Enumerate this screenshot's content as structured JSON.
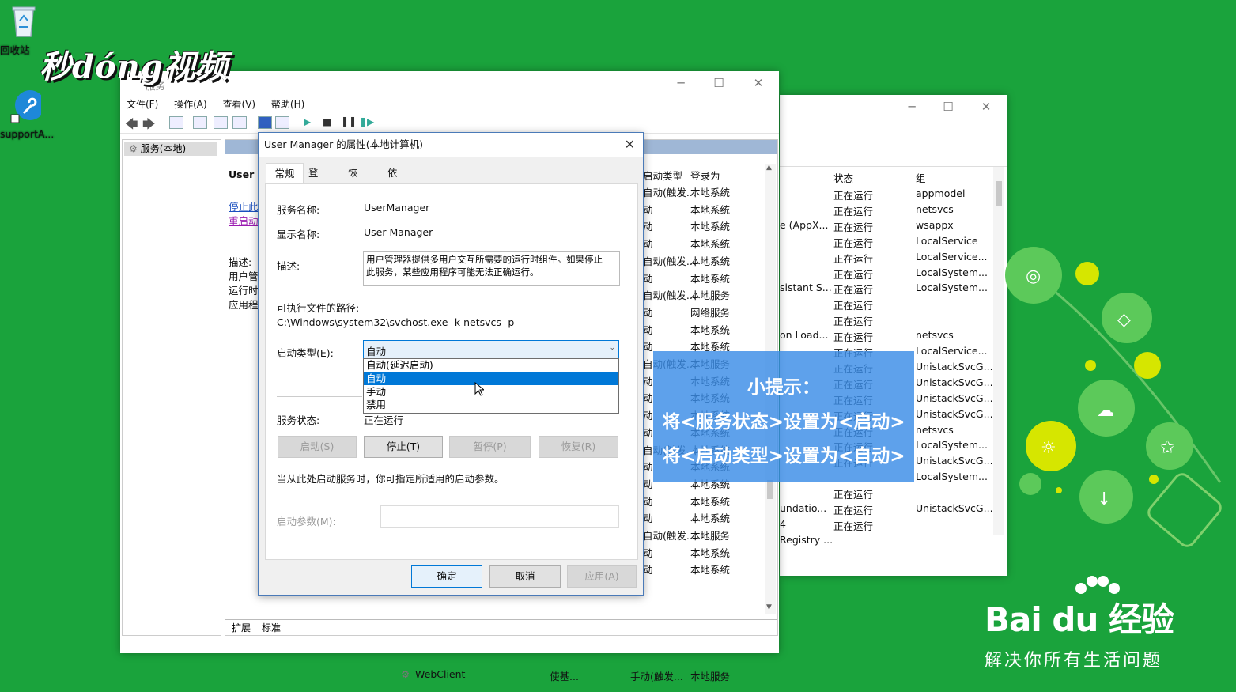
{
  "desktop": {
    "recycle_bin_label": "回收站",
    "support_label": "supportA..."
  },
  "watermark": "秒dóng视频",
  "services_window": {
    "title": "服务",
    "menu": [
      "文件(F)",
      "操作(A)",
      "查看(V)",
      "帮助(H)"
    ],
    "tree_item": "服务(本地)",
    "left_info": {
      "header": "User I",
      "stop_link": "停止此",
      "restart_link": "重启动",
      "desc_label": "描述:",
      "desc_lines": [
        "用户管",
        "运行时",
        "应用程"
      ]
    },
    "columns": {
      "startup_type": "启动类型",
      "logon_as": "登录为"
    },
    "rows_visible": [
      {
        "startup": "自动(触发...",
        "logon": "本地系统"
      },
      {
        "startup": "动",
        "logon": "本地系统"
      },
      {
        "startup": "动",
        "logon": "本地系统"
      },
      {
        "startup": "动",
        "logon": "本地系统"
      },
      {
        "startup": "自动(触发...",
        "logon": "本地系统"
      },
      {
        "startup": "动",
        "logon": "本地系统"
      },
      {
        "startup": "自动(触发...",
        "logon": "本地服务"
      },
      {
        "startup": "动",
        "logon": "网络服务"
      },
      {
        "startup": "动",
        "logon": "本地系统"
      },
      {
        "startup": "动",
        "logon": "本地系统"
      },
      {
        "startup": "自动(触发...",
        "logon": "本地服务"
      },
      {
        "startup": "动",
        "logon": "本地系统"
      },
      {
        "startup": "动",
        "logon": "本地系统"
      },
      {
        "startup": "动",
        "logon": "本地系统"
      },
      {
        "startup": "动",
        "logon": "本地系统"
      },
      {
        "startup": "自动(触发...",
        "logon": "本地系统"
      },
      {
        "startup": "动",
        "logon": "本地系统"
      },
      {
        "startup": "动",
        "logon": "本地系统"
      },
      {
        "startup": "动",
        "logon": "本地系统"
      },
      {
        "startup": "动",
        "logon": "本地系统"
      },
      {
        "startup": "自动(触发...",
        "logon": "本地服务"
      },
      {
        "startup": "动",
        "logon": "本地系统"
      },
      {
        "startup": "动",
        "logon": "本地系统"
      }
    ],
    "webclient_row": {
      "name": "WebClient",
      "desc": "使基...",
      "startup": "手动(触发...",
      "logon": "本地服务"
    },
    "bottom_tabs": [
      "扩展",
      "标准"
    ]
  },
  "back_window": {
    "columns": {
      "status": "状态",
      "group": "组"
    },
    "name_fragments": [
      "e (AppX...",
      "sistant S...",
      "on Load...",
      "undatio...",
      "4",
      "Registry ..."
    ],
    "rows": [
      {
        "status": "正在运行",
        "group": "appmodel"
      },
      {
        "status": "正在运行",
        "group": "netsvcs"
      },
      {
        "status": "正在运行",
        "group": "wsappx"
      },
      {
        "status": "正在运行",
        "group": "LocalService"
      },
      {
        "status": "正在运行",
        "group": "LocalService..."
      },
      {
        "status": "正在运行",
        "group": "LocalSystem..."
      },
      {
        "status": "正在运行",
        "group": "LocalSystem..."
      },
      {
        "status": "正在运行",
        "group": ""
      },
      {
        "status": "正在运行",
        "group": ""
      },
      {
        "status": "正在运行",
        "group": "netsvcs"
      },
      {
        "status": "正在运行",
        "group": "LocalService..."
      },
      {
        "status": "正在运行",
        "group": "UnistackSvcG..."
      },
      {
        "status": "正在运行",
        "group": "UnistackSvcG..."
      },
      {
        "status": "正在运行",
        "group": "UnistackSvcG..."
      },
      {
        "status": "正在运行",
        "group": "UnistackSvcG..."
      },
      {
        "status": "正在运行",
        "group": "netsvcs"
      },
      {
        "status": "正在运行",
        "group": "LocalSystem..."
      },
      {
        "status": "正在运行",
        "group": "UnistackSvcG..."
      },
      {
        "status": "",
        "group": "LocalSystem..."
      },
      {
        "status": "正在运行",
        "group": ""
      },
      {
        "status": "正在运行",
        "group": "UnistackSvcG..."
      },
      {
        "status": "正在运行",
        "group": ""
      }
    ]
  },
  "dialog": {
    "title": "User Manager 的属性(本地计算机)",
    "tabs": [
      "常规",
      "登录",
      "恢复",
      "依存关系"
    ],
    "service_name_label": "服务名称:",
    "service_name_value": "UserManager",
    "display_name_label": "显示名称:",
    "display_name_value": "User Manager",
    "description_label": "描述:",
    "description_value": "用户管理器提供多用户交互所需要的运行时组件。如果停止此服务，某些应用程序可能无法正确运行。",
    "exe_path_label": "可执行文件的路径:",
    "exe_path_value": "C:\\Windows\\system32\\svchost.exe -k netsvcs -p",
    "startup_type_label": "启动类型(E):",
    "startup_type_value": "自动",
    "startup_options": [
      "自动(延迟启动)",
      "自动",
      "手动",
      "禁用"
    ],
    "startup_selected_index": 1,
    "service_status_label": "服务状态:",
    "service_status_value": "正在运行",
    "buttons": {
      "start": "启动(S)",
      "stop": "停止(T)",
      "pause": "暂停(P)",
      "resume": "恢复(R)"
    },
    "params_hint": "当从此处启动服务时，你可指定所适用的启动参数。",
    "params_label": "启动参数(M):",
    "params_value": "",
    "footer": {
      "ok": "确定",
      "cancel": "取消",
      "apply": "应用(A)"
    }
  },
  "tip": {
    "title": "小提示：",
    "line1": "将<服务状态>设置为<启动>",
    "line2": "将<启动类型>设置为<自动>"
  },
  "baidu": {
    "logo_text": "Bai du 经验",
    "slogan": "解决你所有生活问题"
  },
  "colors": {
    "desktop_green": "#1aa33c",
    "tip_blue": "#3a8ce6",
    "selection_blue": "#0078d7"
  }
}
